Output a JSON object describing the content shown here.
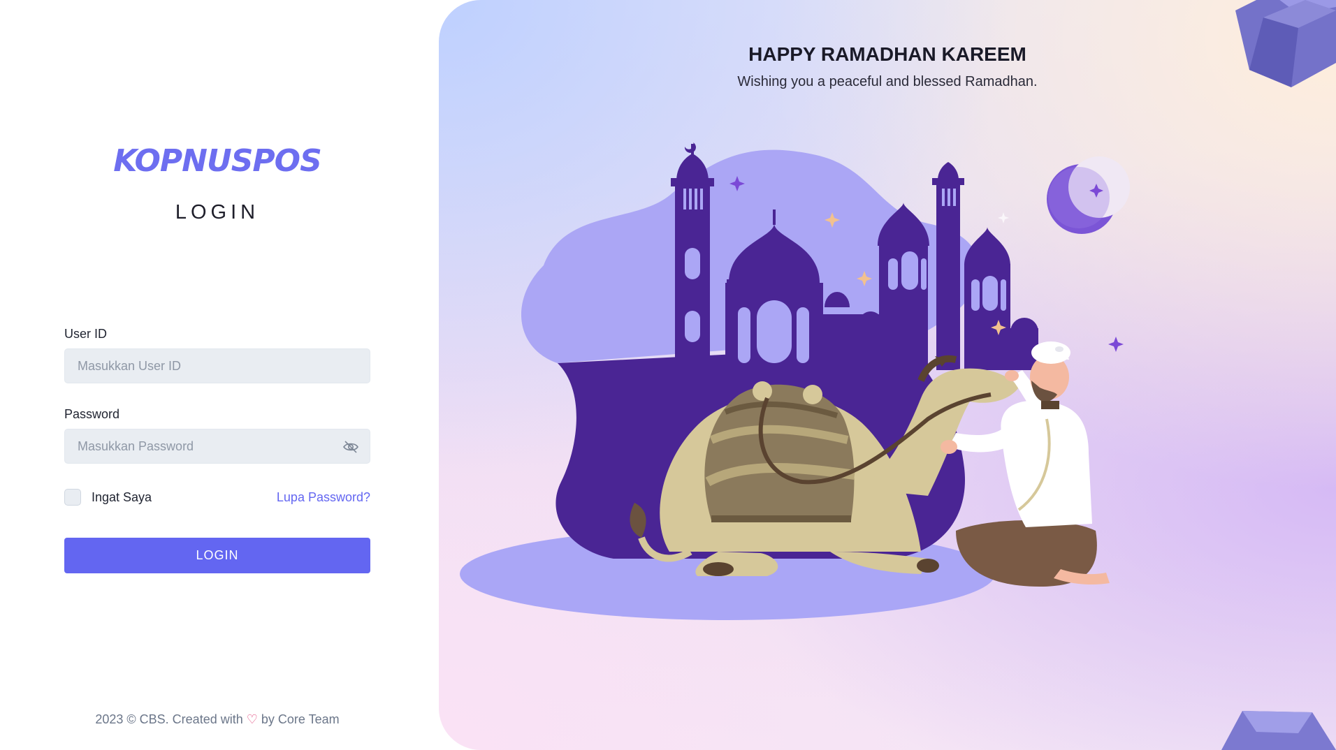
{
  "brand": {
    "name": "KOPNUSPOS"
  },
  "login": {
    "title": "LOGIN",
    "user_id_label": "User ID",
    "user_id_placeholder": "Masukkan User ID",
    "password_label": "Password",
    "password_placeholder": "Masukkan Password",
    "remember_label": "Ingat Saya",
    "forgot_label": "Lupa Password?",
    "submit_label": "LOGIN"
  },
  "footer": {
    "prefix": "2023 © CBS. Created with",
    "heart": "♡",
    "suffix": "by Core Team"
  },
  "banner": {
    "title": "HAPPY RAMADHAN KAREEM",
    "subtitle": "Wishing you a peaceful and blessed Ramadhan."
  },
  "colors": {
    "accent": "#6366f1",
    "brand": "#6d6ef0",
    "mosque": "#4a2594",
    "blob": "#a9a3f5"
  },
  "icons": {
    "password_toggle": "eye-slash-icon"
  }
}
